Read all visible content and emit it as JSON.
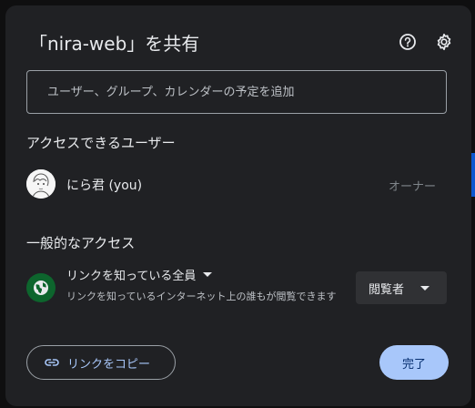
{
  "dialog": {
    "title": "「nira-web」を共有",
    "help_icon": "help-circle-icon",
    "settings_icon": "gear-icon"
  },
  "share_input": {
    "placeholder": "ユーザー、グループ、カレンダーの予定を追加"
  },
  "people_section": {
    "heading": "アクセスできるユーザー",
    "users": [
      {
        "name": "にら君 (you)",
        "role": "オーナー"
      }
    ]
  },
  "general_access": {
    "heading": "一般的なアクセス",
    "setting": "リンクを知っている全員",
    "description": "リンクを知っているインターネット上の誰もが閲覧できます",
    "role": "閲覧者"
  },
  "footer": {
    "copy_link": "リンクをコピー",
    "done": "完了"
  },
  "colors": {
    "dialog_bg": "#202124",
    "accent": "#a8c7fa",
    "globe_bg": "#0d652d"
  }
}
